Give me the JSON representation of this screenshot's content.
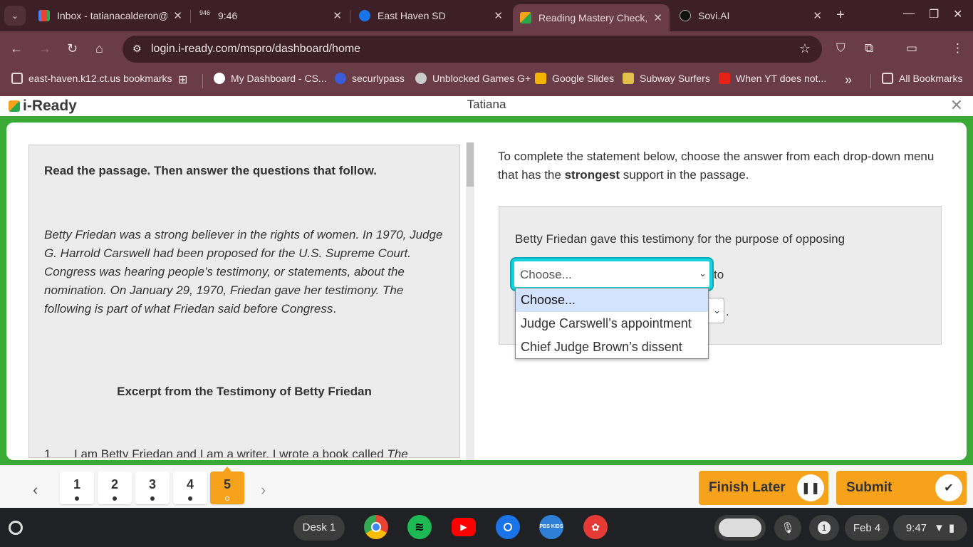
{
  "browser": {
    "tabs": [
      {
        "title": "Inbox - tatianacalderon@",
        "favicon": "gmail-icon",
        "active": false
      },
      {
        "title": "9:46",
        "favicon": "clock-46-icon",
        "active": false
      },
      {
        "title": "East Haven SD",
        "favicon": "cloud-icon",
        "active": false
      },
      {
        "title": "Reading Mastery Check, ",
        "favicon": "cube-icon",
        "active": true
      },
      {
        "title": "Sovi.AI",
        "favicon": "sovi-icon",
        "active": false
      }
    ],
    "clock_favicon_text": "946",
    "url": "login.i-ready.com/mspro/dashboard/home",
    "bookmarks": [
      {
        "label": "east-haven.k12.ct.us bookmarks"
      },
      {
        "label": "My Dashboard - CS..."
      },
      {
        "label": "securlypass"
      },
      {
        "label": "Unblocked Games G+"
      },
      {
        "label": "Google Slides"
      },
      {
        "label": "Subway Surfers"
      },
      {
        "label": "When YT does not..."
      },
      {
        "label": "All Bookmarks"
      }
    ],
    "overflow_label": "»"
  },
  "app": {
    "logo": "i-Ready",
    "student_name": "Tatiana",
    "close_label": "✕"
  },
  "passage": {
    "instruction": "Read the passage. Then answer the questions that follow.",
    "intro_main": "Betty Friedan was a strong believer in the rights of women. In 1970, Judge G. Harrold Carswell had been proposed for the U.S. Supreme Court. Congress was hearing people’s testimony, or statements, about the nomination. On January 29, 1970, Friedan gave her testimony. The following is part of what Friedan said before Congress",
    "intro_end": ".",
    "excerpt_title": "Excerpt from the Testimony of Betty Friedan",
    "para1_num": "1",
    "para1_text": "I am Betty Friedan and I am a writer. I wrote a book called ",
    "para1_italic": "The"
  },
  "question": {
    "prompt_before": "To complete the statement below, choose the answer from each drop-down menu that has the ",
    "prompt_bold": "strongest",
    "prompt_after": " support in the passage.",
    "stem": "Betty Friedan gave this testimony for the purpose of opposing",
    "select1_value": "Choose...",
    "to_word": "to",
    "period": ".",
    "options": [
      "Choose...",
      "Judge Carswell’s appointment",
      "Chief Judge Brown’s dissent"
    ]
  },
  "footer": {
    "pages": [
      "1",
      "2",
      "3",
      "4",
      "5"
    ],
    "current_page": "5",
    "finish_later": "Finish Later",
    "submit": "Submit"
  },
  "shelf": {
    "desk_label": "Desk 1",
    "notification_count": "1",
    "date": "Feb 4",
    "time": "9:47",
    "pbs_label": "PBS KIDS"
  },
  "colors": {
    "chrome_dark": "#3c1f27",
    "chrome_mid": "#6a3c47",
    "iready_green": "#3aaa36",
    "iready_orange": "#f7a21b",
    "focus_cyan": "#14d2de"
  }
}
